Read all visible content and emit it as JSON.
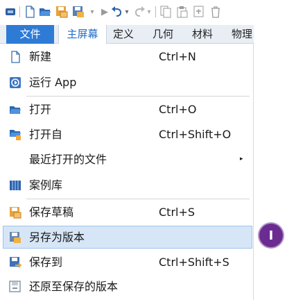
{
  "toolbar": {
    "icons": [
      "app-icon",
      "new-file-icon",
      "open-folder-icon",
      "save-draft-icon",
      "save-as-icon",
      "run-icon",
      "undo-icon",
      "redo-icon",
      "copy-icon",
      "paste-icon",
      "duplicate-icon",
      "delete-icon"
    ]
  },
  "tabs": [
    {
      "label": "文件",
      "active": true
    },
    {
      "label": "主屏幕"
    },
    {
      "label": "定义"
    },
    {
      "label": "几何"
    },
    {
      "label": "材料"
    },
    {
      "label": "物理"
    }
  ],
  "menu": {
    "items": [
      {
        "label": "新建",
        "shortcut": "Ctrl+N",
        "icon": "new-file-icon"
      },
      {
        "label": "运行 App",
        "shortcut": "",
        "icon": "run-app-icon"
      },
      {
        "label": "打开",
        "shortcut": "Ctrl+O",
        "icon": "open-folder-icon"
      },
      {
        "label": "打开自",
        "shortcut": "Ctrl+Shift+O",
        "icon": "open-from-icon"
      },
      {
        "label": "最近打开的文件",
        "shortcut": "",
        "icon": "",
        "submenu": true
      },
      {
        "label": "案例库",
        "shortcut": "",
        "icon": "library-icon"
      },
      {
        "label": "保存草稿",
        "shortcut": "Ctrl+S",
        "icon": "save-draft-icon"
      },
      {
        "label": "另存为版本",
        "shortcut": "",
        "icon": "save-version-icon",
        "highlighted": true
      },
      {
        "label": "保存到",
        "shortcut": "Ctrl+Shift+S",
        "icon": "save-to-icon"
      },
      {
        "label": "还原至保存的版本",
        "shortcut": "",
        "icon": "revert-icon"
      }
    ],
    "submenu_arrow": "▸"
  },
  "marker": {
    "label": "I"
  },
  "colors": {
    "accent": "#2e7bd6",
    "highlight": "#d6e6f7",
    "marker": "#6b2c91"
  }
}
